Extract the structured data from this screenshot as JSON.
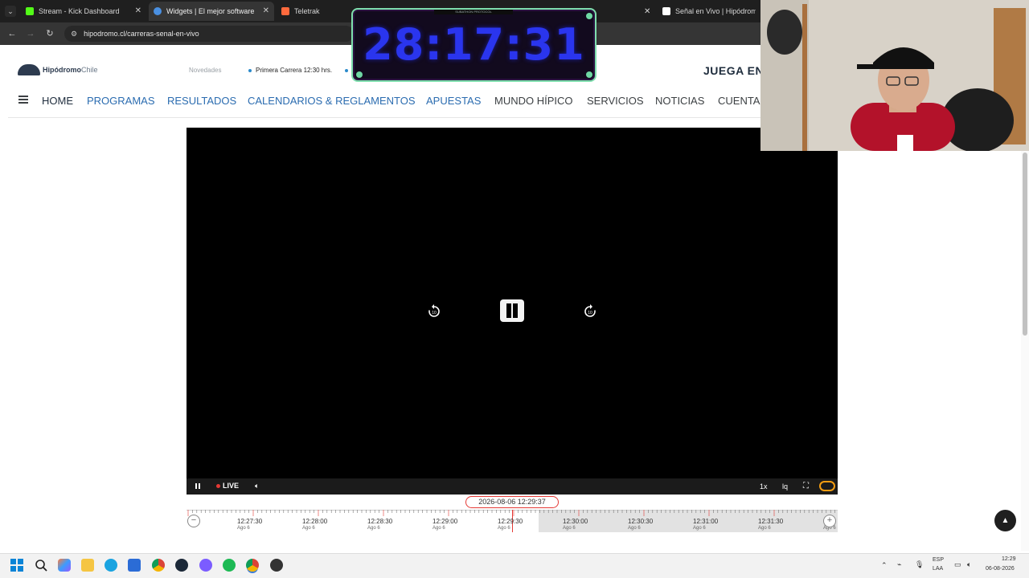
{
  "browser": {
    "tabs": [
      {
        "label": "Stream - Kick Dashboard",
        "active": false,
        "color": "#53fc18"
      },
      {
        "label": "Widgets | El mejor software pa",
        "active": true,
        "color": "#4a90e2"
      },
      {
        "label": "Teletrak",
        "active": false,
        "color": "#ff6a3d"
      },
      {
        "label": "Señal en Vivo | Hipódromo Ch",
        "active": false,
        "color": "#ffffff"
      }
    ],
    "url": "hipodromo.cl/carreras-senal-en-vivo"
  },
  "site": {
    "logo_bold": "Hipódromo",
    "logo_light": "Chile",
    "news_label": "Novedades",
    "news_item": "Primera Carrera 12:30 hrs.",
    "cta": "JUEGA EN",
    "nav": [
      {
        "label": "HOME",
        "color": "#1f2d3d"
      },
      {
        "label": "PROGRAMAS",
        "color": "#2b6cb0"
      },
      {
        "label": "RESULTADOS",
        "color": "#2b6cb0"
      },
      {
        "label": "CALENDARIOS & REGLAMENTOS",
        "color": "#2b6cb0"
      },
      {
        "label": "APUESTAS",
        "color": "#2b6cb0"
      },
      {
        "label": "MUNDO HÍPICO",
        "color": "#3c4043"
      },
      {
        "label": "SERVICIOS",
        "color": "#3c4043"
      },
      {
        "label": "NOTICIAS",
        "color": "#3c4043"
      },
      {
        "label": "CUENTA",
        "color": "#3c4043"
      }
    ]
  },
  "player": {
    "live_label": "LIVE",
    "speed": "1x",
    "quality": "lq",
    "timestamp": "2026-08-06 12:29:37",
    "timeline": [
      {
        "time": "12:27:30",
        "date": "Ago 6"
      },
      {
        "time": "12:28:00",
        "date": "Ago 6"
      },
      {
        "time": "12:28:30",
        "date": "Ago 6"
      },
      {
        "time": "12:29:00",
        "date": "Ago 6"
      },
      {
        "time": "12:29:30",
        "date": "Ago 6"
      },
      {
        "time": "12:30:00",
        "date": "Ago 6"
      },
      {
        "time": "12:30:30",
        "date": "Ago 6"
      },
      {
        "time": "12:31:00",
        "date": "Ago 6"
      },
      {
        "time": "12:31:30",
        "date": "Ago 6"
      }
    ],
    "timeline_end_date": "Ago 6"
  },
  "overlay": {
    "timer_header": "SUBATHON PROTOCOL",
    "timer": "28:17:31",
    "timer_color": "#2a35ee"
  },
  "taskbar": {
    "lang_top": "ESP",
    "lang_bottom": "LAA",
    "clock_time": "12:29",
    "clock_date": "06-08-2026"
  }
}
